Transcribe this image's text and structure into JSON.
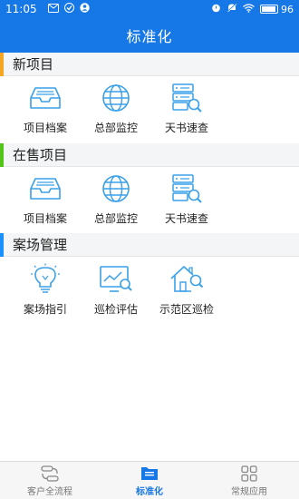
{
  "status_bar": {
    "time": "11:05",
    "battery": "96"
  },
  "header": {
    "title": "标准化"
  },
  "colors": {
    "primary": "#1677e6",
    "section_new": "#f5a623",
    "section_sale": "#52c41a",
    "section_case": "#1890ff",
    "icon": "#3aa0e8"
  },
  "sections": [
    {
      "title": "新项目",
      "items": [
        {
          "label": "项目档案",
          "icon": "inbox-tray-icon"
        },
        {
          "label": "总部监控",
          "icon": "globe-icon"
        },
        {
          "label": "天书速查",
          "icon": "server-search-icon"
        }
      ]
    },
    {
      "title": "在售项目",
      "items": [
        {
          "label": "项目档案",
          "icon": "inbox-tray-icon"
        },
        {
          "label": "总部监控",
          "icon": "globe-icon"
        },
        {
          "label": "天书速查",
          "icon": "server-search-icon"
        }
      ]
    },
    {
      "title": "案场管理",
      "items": [
        {
          "label": "案场指引",
          "icon": "lightbulb-icon"
        },
        {
          "label": "巡检评估",
          "icon": "chart-monitor-icon"
        },
        {
          "label": "示范区巡检",
          "icon": "house-search-icon"
        }
      ]
    }
  ],
  "tabs": [
    {
      "label": "客户全流程",
      "icon": "flow-icon",
      "active": false
    },
    {
      "label": "标准化",
      "icon": "folder-icon",
      "active": true
    },
    {
      "label": "常规应用",
      "icon": "grid-icon",
      "active": false
    }
  ]
}
